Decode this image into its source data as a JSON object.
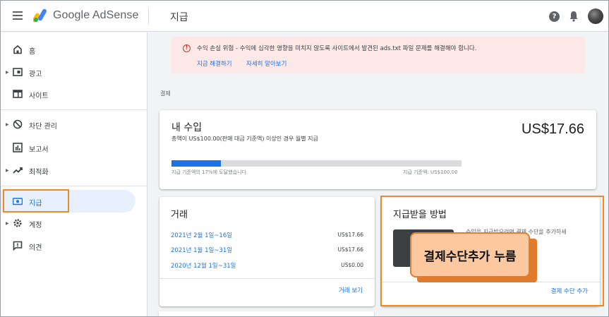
{
  "header": {
    "brand": "Google AdSense",
    "page_title": "지급",
    "help_icon": "help-icon",
    "notification_icon": "bell-icon",
    "account_icon": "avatar"
  },
  "sidebar": {
    "items": [
      {
        "label": "홈",
        "icon": "home-icon",
        "expandable": false
      },
      {
        "label": "광고",
        "icon": "ads-icon",
        "expandable": true
      },
      {
        "label": "사이트",
        "icon": "sites-icon",
        "expandable": false
      },
      {
        "label": "차단 관리",
        "icon": "block-icon",
        "expandable": true
      },
      {
        "label": "보고서",
        "icon": "reports-icon",
        "expandable": false
      },
      {
        "label": "최적화",
        "icon": "optimization-icon",
        "expandable": true
      },
      {
        "label": "지급",
        "icon": "payments-icon",
        "expandable": false,
        "active": true
      },
      {
        "label": "계정",
        "icon": "gear-icon",
        "expandable": true
      },
      {
        "label": "의견",
        "icon": "feedback-icon",
        "expandable": false
      }
    ]
  },
  "alert": {
    "message": "수익 손실 위험 - 수익에 심각한 영향을 미치지 않도록 사이트에서 발견된 ads.txt 파일 문제를 해결해야 합니다.",
    "fix_link": "지금 해결하기",
    "learn_link": "자세히 알아보기"
  },
  "section_label": "결제",
  "earnings": {
    "title": "내 수입",
    "subtitle": "총액이 US$100.00(판매 대금 기준액) 이상인 경우 월별 지급",
    "amount": "US$17.66",
    "progress_fraction": 0.17,
    "progress_left": "지급 기준액의 17%에 도달했습니다.",
    "progress_right": "지급 기준액: US$100.00"
  },
  "transactions": {
    "title": "거래",
    "rows": [
      {
        "date": "2021년 2월 1일~16일",
        "amount": "US$17.66"
      },
      {
        "date": "2021년 1월 1일~31일",
        "amount": "US$17.66"
      },
      {
        "date": "2020년 12월 1일~31일",
        "amount": "US$0.00"
      }
    ],
    "view_link": "거래 보기"
  },
  "payment_method": {
    "title": "지급받을 방법",
    "description": "수입을 지급받으려면 결제 수단을 추가하세",
    "add_link": "결제 수단 추가"
  },
  "annotation": {
    "callout": "결제수단추가 누름"
  },
  "colors": {
    "accent": "#1a73e8",
    "highlight": "#f08a24",
    "alert_bg": "#fce8e6",
    "callout_bg": "#fcc8a0"
  }
}
